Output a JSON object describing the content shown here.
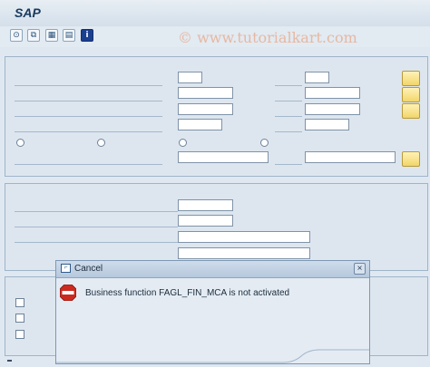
{
  "app": {
    "title": "SAP"
  },
  "toolbar": {
    "watermark": "© www.tutorialkart.com",
    "buttons": [
      {
        "name": "execute-icon",
        "glyph": "⊙"
      },
      {
        "name": "copy-icon",
        "glyph": "⧉"
      },
      {
        "name": "variant-icon",
        "glyph": "▦"
      },
      {
        "name": "selection-icon",
        "glyph": "▤"
      },
      {
        "name": "info-icon",
        "glyph": "i"
      }
    ]
  },
  "dialog": {
    "title": "Cancel",
    "message": "Business function FAGL_FIN_MCA is not activated",
    "close_glyph": "×",
    "window_icon_glyph": "⌐"
  },
  "colors": {
    "stop": "#cc2a1f",
    "panel": "#dde6ef",
    "button_yellow": "#f2d56a"
  }
}
